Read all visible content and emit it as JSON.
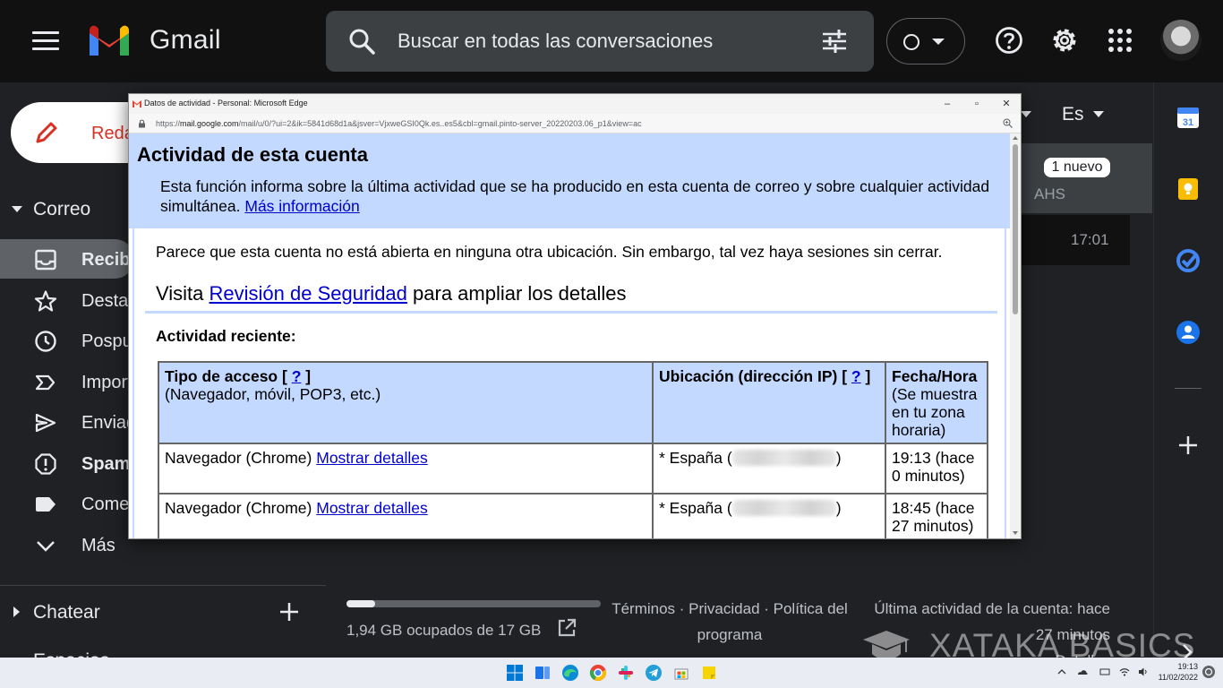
{
  "header": {
    "app_name": "Gmail",
    "search_placeholder": "Buscar en todas las conversaciones"
  },
  "sidebar": {
    "compose_label": "Redactar",
    "mail_section": "Correo",
    "items": [
      {
        "label": "Recibidos",
        "icon": "inbox-icon",
        "active": true,
        "bold": true
      },
      {
        "label": "Destacados",
        "icon": "star-icon"
      },
      {
        "label": "Pospuestos",
        "icon": "clock-icon"
      },
      {
        "label": "Importantes",
        "icon": "label-important-icon"
      },
      {
        "label": "Enviados",
        "icon": "send-icon"
      },
      {
        "label": "Spam",
        "icon": "spam-icon",
        "bold": true
      },
      {
        "label": "Comercial",
        "icon": "tag-icon"
      },
      {
        "label": "Más",
        "icon": "chevron-down-icon"
      }
    ],
    "chat_section": "Chatear",
    "spaces_section": "Espacios"
  },
  "mail_area": {
    "language": "Es",
    "new_badge": "1 nuevo",
    "sender": "AHS",
    "time": "17:01"
  },
  "footer": {
    "storage": "1,94 GB ocupados de 17 GB",
    "storage_fraction": 0.114,
    "links": "Términos · Privacidad · Política del programa",
    "last_activity": "Última actividad de la cuenta: hace 27 minutos",
    "details": "Detalles"
  },
  "watermark": "XATAKA BASICS",
  "popup": {
    "window_title": "Datos de actividad - Personal: Microsoft Edge",
    "url_prefix": "https://",
    "url_host": "mail.google.com",
    "url_rest": "/mail/u/0/?ui=2&ik=5841d68d1a&jsver=VjxweGSI0Qk.es..es5&cbl=gmail.pinto-server_20220203.06_p1&view=ac",
    "title": "Actividad de esta cuenta",
    "description": "Esta función informa sobre la última actividad que se ha producido en esta cuenta de correo y sobre cualquier actividad simultánea.",
    "more_info_link": "Más información",
    "note": "Parece que esta cuenta no está abierta en ninguna otra ubicación. Sin embargo, tal vez haya sesiones sin cerrar.",
    "visit_prefix": "Visita",
    "security_link": "Revisión de Seguridad",
    "visit_suffix": "para ampliar los detalles",
    "recent_heading": "Actividad reciente:",
    "table": {
      "col1_title": "Tipo de acceso [",
      "col1_help": "?",
      "col1_close": "]",
      "col1_sub": "(Navegador, móvil, POP3, etc.)",
      "col2_title": "Ubicación (dirección IP) [",
      "col2_help": "?",
      "col2_close": "]",
      "col3_title": "Fecha/Hora",
      "col3_sub": "(Se muestra en tu zona horaria)",
      "rows": [
        {
          "access": "Navegador (Chrome)",
          "details_link": "Mostrar detalles",
          "location": "* España (",
          "loc_close": ")",
          "datetime": "19:13 (hace 0 minutos)"
        },
        {
          "access": "Navegador (Chrome)",
          "details_link": "Mostrar detalles",
          "location": "* España (",
          "loc_close": ")",
          "datetime": "18:45 (hace 27 minutos)"
        }
      ]
    }
  },
  "taskbar": {
    "time": "19:13",
    "date": "11/02/2022"
  }
}
